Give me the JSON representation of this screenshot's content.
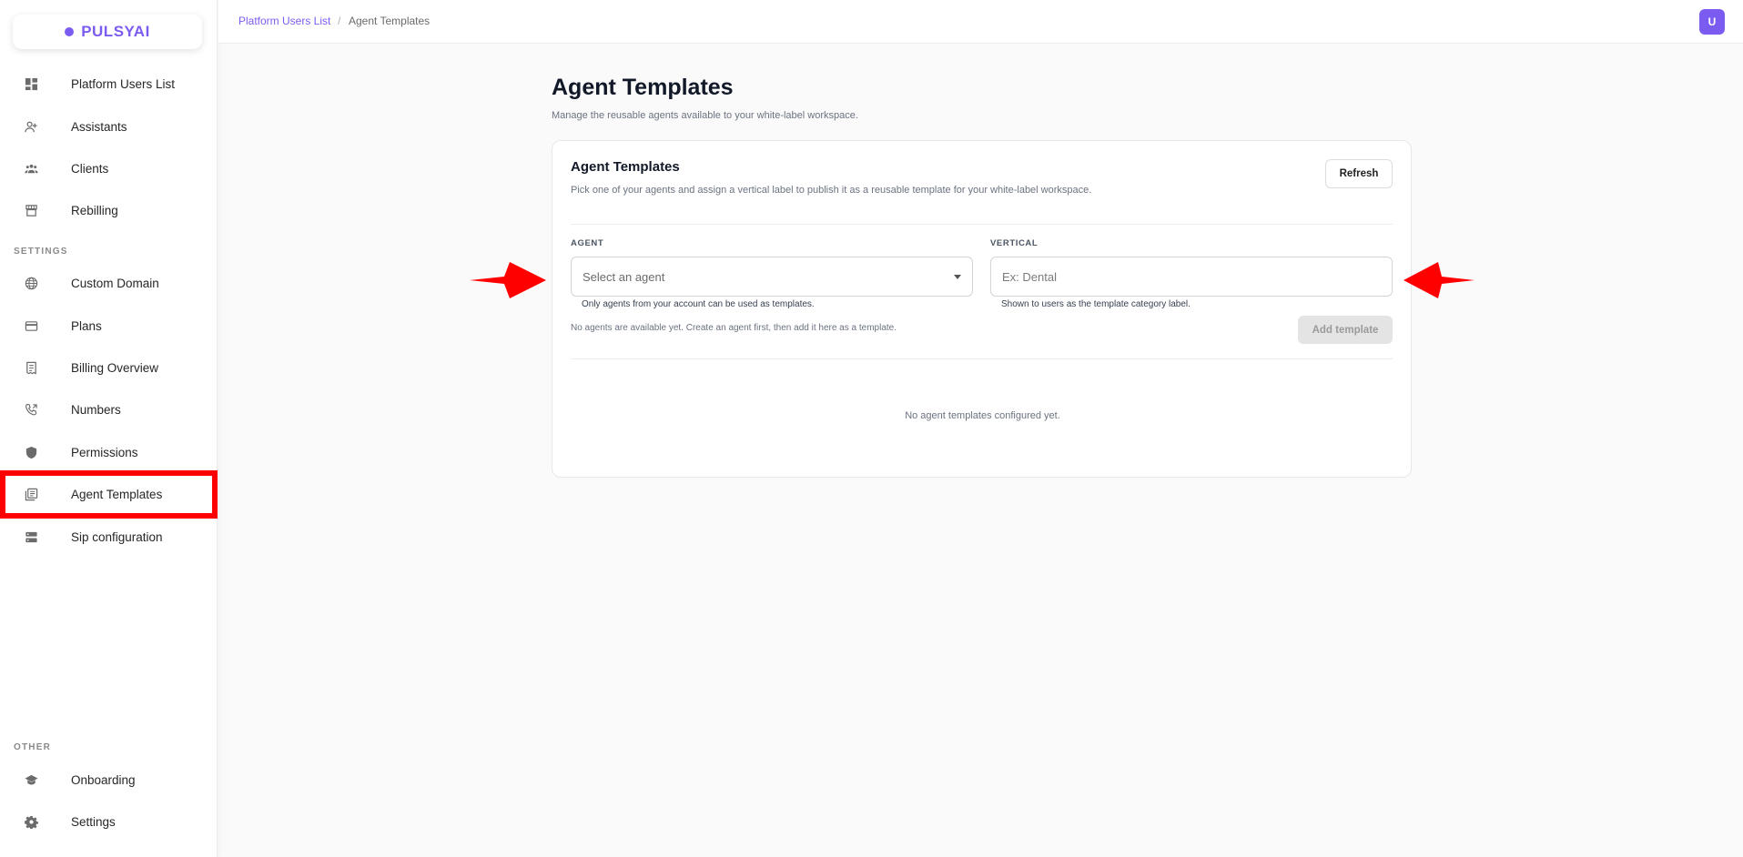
{
  "brand": {
    "name": "PULSYAI",
    "color": "#7c5cf0"
  },
  "sidebar": {
    "items": [
      {
        "label": "Platform Users List",
        "icon": "dashboard-icon"
      },
      {
        "label": "Assistants",
        "icon": "user-plus-icon"
      },
      {
        "label": "Clients",
        "icon": "group-icon"
      },
      {
        "label": "Rebilling",
        "icon": "storefront-icon"
      }
    ],
    "settings_label": "SETTINGS",
    "settings_items": [
      {
        "label": "Custom Domain",
        "icon": "globe-icon"
      },
      {
        "label": "Plans",
        "icon": "credit-card-icon"
      },
      {
        "label": "Billing Overview",
        "icon": "receipt-icon"
      },
      {
        "label": "Numbers",
        "icon": "phone-forward-icon"
      },
      {
        "label": "Permissions",
        "icon": "shield-icon"
      },
      {
        "label": "Agent Templates",
        "icon": "library-books-icon"
      },
      {
        "label": "Sip configuration",
        "icon": "dns-icon"
      }
    ],
    "other_label": "OTHER",
    "other_items": [
      {
        "label": "Onboarding",
        "icon": "graduation-cap-icon"
      },
      {
        "label": "Settings",
        "icon": "gear-icon"
      }
    ]
  },
  "topbar": {
    "breadcrumb_root": "Platform Users List",
    "breadcrumb_sep": "/",
    "breadcrumb_current": "Agent Templates",
    "avatar_initial": "U"
  },
  "main": {
    "title": "Agent Templates",
    "subtitle": "Manage the reusable agents available to your white-label workspace.",
    "card": {
      "title": "Agent Templates",
      "description": "Pick one of your agents and assign a vertical label to publish it as a reusable template for your white-label workspace.",
      "refresh_label": "Refresh",
      "agent_label": "AGENT",
      "agent_placeholder": "Select an agent",
      "agent_helper": "Only agents from your account can be used as templates.",
      "vertical_label": "VERTICAL",
      "vertical_placeholder": "Ex: Dental",
      "vertical_helper": "Shown to users as the template category label.",
      "no_agents_note": "No agents are available yet. Create an agent first, then add it here as a template.",
      "add_label": "Add template",
      "empty_state": "No agent templates configured yet."
    }
  },
  "colors": {
    "accent": "#7c5cf0",
    "highlight": "#ff0000"
  }
}
